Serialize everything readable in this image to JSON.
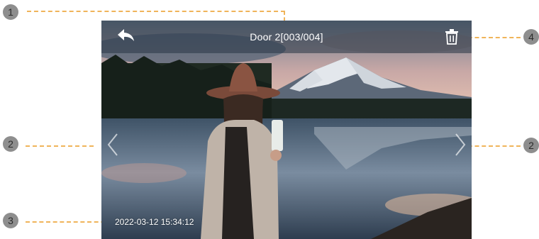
{
  "callouts": [
    "1",
    "2",
    "3",
    "4",
    "2"
  ],
  "screen": {
    "title": "Door 2[003/004]",
    "timestamp": "2022-03-12 15:34:12"
  },
  "icons": {
    "back": "back-arrow-icon",
    "delete": "trash-icon",
    "prev": "chevron-left-icon",
    "next": "chevron-right-icon"
  },
  "colors": {
    "callout_line": "#f0b45a",
    "callout_marker": "#8e8e8e",
    "topbar": "#28344a"
  }
}
